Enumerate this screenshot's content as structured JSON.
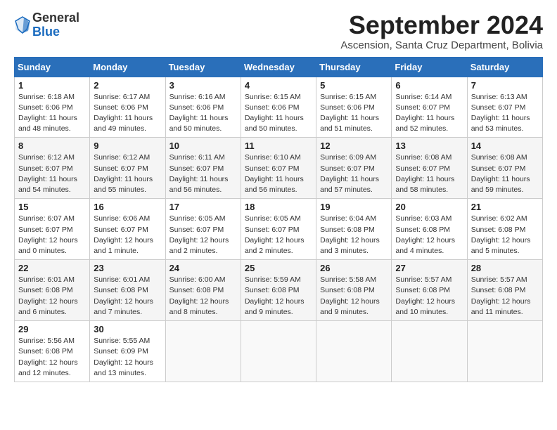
{
  "logo": {
    "general": "General",
    "blue": "Blue"
  },
  "title": "September 2024",
  "location": "Ascension, Santa Cruz Department, Bolivia",
  "weekdays": [
    "Sunday",
    "Monday",
    "Tuesday",
    "Wednesday",
    "Thursday",
    "Friday",
    "Saturday"
  ],
  "weeks": [
    [
      {
        "day": "1",
        "sunrise": "6:18 AM",
        "sunset": "6:06 PM",
        "daylight": "11 hours and 48 minutes."
      },
      {
        "day": "2",
        "sunrise": "6:17 AM",
        "sunset": "6:06 PM",
        "daylight": "11 hours and 49 minutes."
      },
      {
        "day": "3",
        "sunrise": "6:16 AM",
        "sunset": "6:06 PM",
        "daylight": "11 hours and 50 minutes."
      },
      {
        "day": "4",
        "sunrise": "6:15 AM",
        "sunset": "6:06 PM",
        "daylight": "11 hours and 50 minutes."
      },
      {
        "day": "5",
        "sunrise": "6:15 AM",
        "sunset": "6:06 PM",
        "daylight": "11 hours and 51 minutes."
      },
      {
        "day": "6",
        "sunrise": "6:14 AM",
        "sunset": "6:07 PM",
        "daylight": "11 hours and 52 minutes."
      },
      {
        "day": "7",
        "sunrise": "6:13 AM",
        "sunset": "6:07 PM",
        "daylight": "11 hours and 53 minutes."
      }
    ],
    [
      {
        "day": "8",
        "sunrise": "6:12 AM",
        "sunset": "6:07 PM",
        "daylight": "11 hours and 54 minutes."
      },
      {
        "day": "9",
        "sunrise": "6:12 AM",
        "sunset": "6:07 PM",
        "daylight": "11 hours and 55 minutes."
      },
      {
        "day": "10",
        "sunrise": "6:11 AM",
        "sunset": "6:07 PM",
        "daylight": "11 hours and 56 minutes."
      },
      {
        "day": "11",
        "sunrise": "6:10 AM",
        "sunset": "6:07 PM",
        "daylight": "11 hours and 56 minutes."
      },
      {
        "day": "12",
        "sunrise": "6:09 AM",
        "sunset": "6:07 PM",
        "daylight": "11 hours and 57 minutes."
      },
      {
        "day": "13",
        "sunrise": "6:08 AM",
        "sunset": "6:07 PM",
        "daylight": "11 hours and 58 minutes."
      },
      {
        "day": "14",
        "sunrise": "6:08 AM",
        "sunset": "6:07 PM",
        "daylight": "11 hours and 59 minutes."
      }
    ],
    [
      {
        "day": "15",
        "sunrise": "6:07 AM",
        "sunset": "6:07 PM",
        "daylight": "12 hours and 0 minutes."
      },
      {
        "day": "16",
        "sunrise": "6:06 AM",
        "sunset": "6:07 PM",
        "daylight": "12 hours and 1 minute."
      },
      {
        "day": "17",
        "sunrise": "6:05 AM",
        "sunset": "6:07 PM",
        "daylight": "12 hours and 2 minutes."
      },
      {
        "day": "18",
        "sunrise": "6:05 AM",
        "sunset": "6:07 PM",
        "daylight": "12 hours and 2 minutes."
      },
      {
        "day": "19",
        "sunrise": "6:04 AM",
        "sunset": "6:08 PM",
        "daylight": "12 hours and 3 minutes."
      },
      {
        "day": "20",
        "sunrise": "6:03 AM",
        "sunset": "6:08 PM",
        "daylight": "12 hours and 4 minutes."
      },
      {
        "day": "21",
        "sunrise": "6:02 AM",
        "sunset": "6:08 PM",
        "daylight": "12 hours and 5 minutes."
      }
    ],
    [
      {
        "day": "22",
        "sunrise": "6:01 AM",
        "sunset": "6:08 PM",
        "daylight": "12 hours and 6 minutes."
      },
      {
        "day": "23",
        "sunrise": "6:01 AM",
        "sunset": "6:08 PM",
        "daylight": "12 hours and 7 minutes."
      },
      {
        "day": "24",
        "sunrise": "6:00 AM",
        "sunset": "6:08 PM",
        "daylight": "12 hours and 8 minutes."
      },
      {
        "day": "25",
        "sunrise": "5:59 AM",
        "sunset": "6:08 PM",
        "daylight": "12 hours and 9 minutes."
      },
      {
        "day": "26",
        "sunrise": "5:58 AM",
        "sunset": "6:08 PM",
        "daylight": "12 hours and 9 minutes."
      },
      {
        "day": "27",
        "sunrise": "5:57 AM",
        "sunset": "6:08 PM",
        "daylight": "12 hours and 10 minutes."
      },
      {
        "day": "28",
        "sunrise": "5:57 AM",
        "sunset": "6:08 PM",
        "daylight": "12 hours and 11 minutes."
      }
    ],
    [
      {
        "day": "29",
        "sunrise": "5:56 AM",
        "sunset": "6:08 PM",
        "daylight": "12 hours and 12 minutes."
      },
      {
        "day": "30",
        "sunrise": "5:55 AM",
        "sunset": "6:09 PM",
        "daylight": "12 hours and 13 minutes."
      },
      null,
      null,
      null,
      null,
      null
    ]
  ]
}
